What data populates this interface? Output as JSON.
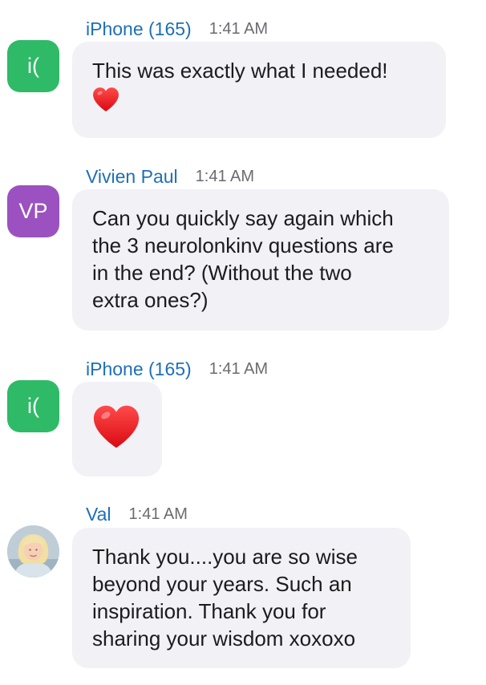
{
  "messages": [
    {
      "sender": "iPhone (165)",
      "time": "1:41 AM",
      "avatar_text": "i(",
      "avatar_color": "#2fba67",
      "lines": [
        "This was exactly what I needed!"
      ],
      "emoji": "heart-icon"
    },
    {
      "sender": "Vivien Paul",
      "time": "1:41 AM",
      "avatar_text": "VP",
      "avatar_color": "#9b52c0",
      "lines": [
        "Can you quickly say again which",
        "the 3 neurolonkinv questions are",
        "in the end? (Without the two",
        "extra ones?)"
      ]
    },
    {
      "sender": "iPhone (165)",
      "time": "1:41 AM",
      "avatar_text": "i(",
      "avatar_color": "#2fba67",
      "emoji": "heart-icon"
    },
    {
      "sender": "Val",
      "time": "1:41 AM",
      "avatar": "profile-photo",
      "lines": [
        "Thank you....you are so wise",
        "beyond your years.  Such an",
        "inspiration.  Thank you for",
        "sharing your wisdom xoxoxo"
      ]
    }
  ],
  "colors": {
    "sender_name": "#1e6fb8",
    "timestamp": "#6b6b70",
    "bubble_bg": "#f1f1f6",
    "heart": "#e8151b"
  }
}
